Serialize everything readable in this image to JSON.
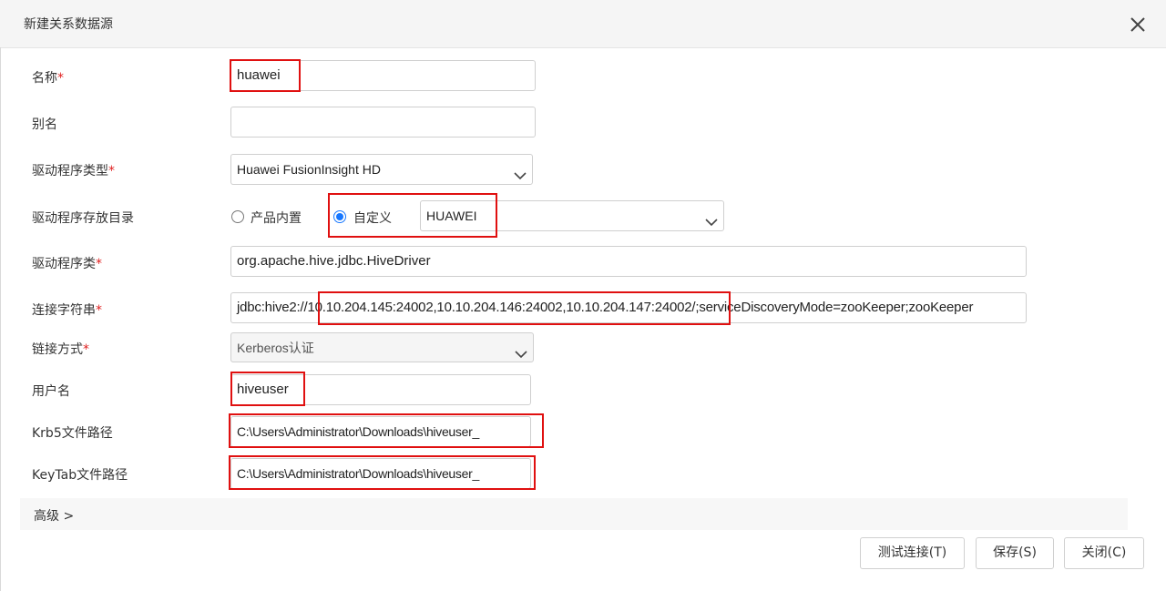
{
  "dialog": {
    "title": "新建关系数据源",
    "close_icon": "close-icon"
  },
  "form": {
    "name": {
      "label": "名称",
      "required": "*",
      "value": "huawei"
    },
    "alias": {
      "label": "别名",
      "value": ""
    },
    "driver_type": {
      "label": "驱动程序类型",
      "required": "*",
      "value": "Huawei FusionInsight HD"
    },
    "driver_dir": {
      "label": "驱动程序存放目录",
      "option_builtin": "产品内置",
      "option_custom": "自定义",
      "selected": "custom",
      "custom_value": "HUAWEI"
    },
    "driver_class": {
      "label": "驱动程序类",
      "required": "*",
      "value": "org.apache.hive.jdbc.HiveDriver"
    },
    "conn_string": {
      "label": "连接字符串",
      "required": "*",
      "prefix": "jdbc:hive2://",
      "hosts": "10.10.204.145:24002,10.10.204.146:24002,10.10.204.147:24002",
      "suffix": "/;serviceDiscoveryMode=zooKeeper;zooKeeper"
    },
    "auth_mode": {
      "label": "链接方式",
      "required": "*",
      "value": "Kerberos认证"
    },
    "username": {
      "label": "用户名",
      "value": "hiveuser"
    },
    "krb5_path": {
      "label": "Krb5文件路径",
      "value": "C:\\Users\\Administrator\\Downloads\\hiveuser_"
    },
    "keytab_path": {
      "label": "KeyTab文件路径",
      "value": "C:\\Users\\Administrator\\Downloads\\hiveuser_"
    }
  },
  "advanced": {
    "label": "高级",
    "chevron": ">"
  },
  "buttons": {
    "test": "测试连接(T)",
    "save": "保存(S)",
    "close": "关闭(C)"
  },
  "colors": {
    "highlight": "#e01010",
    "radio_selected": "#1677ff",
    "required": "#e02020"
  }
}
